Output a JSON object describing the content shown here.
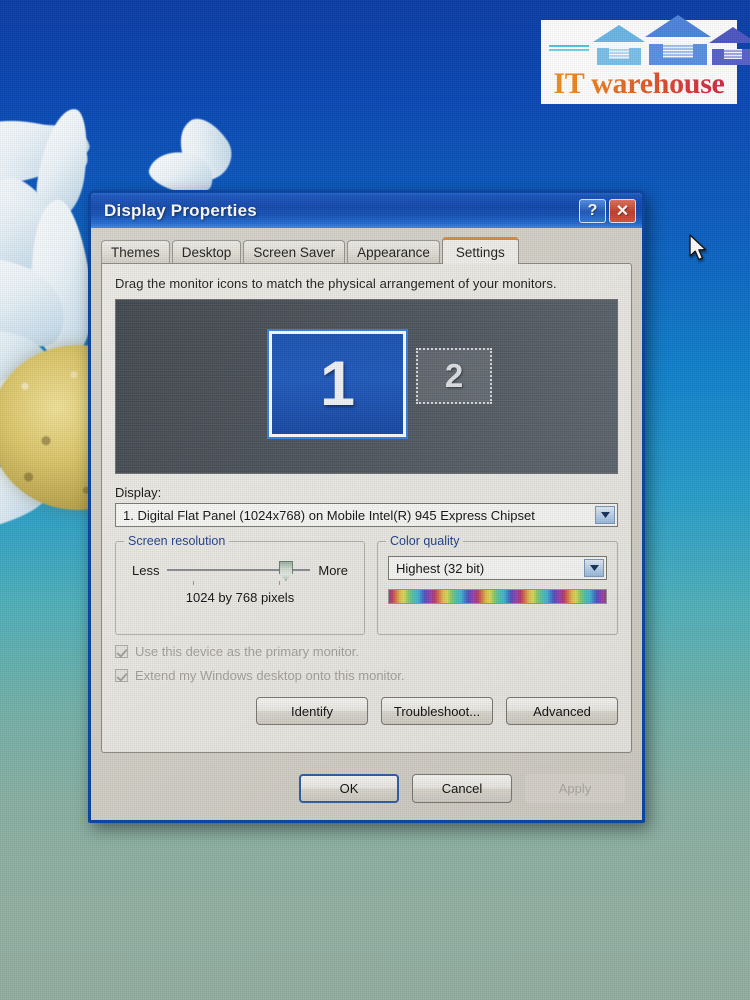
{
  "logo": {
    "text": "IT warehouse",
    "icon_name": "warehouse-logo",
    "colors": {
      "text_start": "#f0931f",
      "text_end": "#cf2a45",
      "house_left": "#6cb8e8",
      "house_center": "#4f86de",
      "house_right": "#5a5fc6",
      "line_left": "#49c2d8",
      "line_right": "#7a6cc8"
    }
  },
  "desktop": {
    "wallpaper_name": "daisy-flower-wallpaper",
    "cursor_name": "arrow-cursor"
  },
  "dialog": {
    "title": "Display Properties",
    "help_button": "?",
    "close_button": "✕",
    "tabs": [
      {
        "label": "Themes",
        "active": false
      },
      {
        "label": "Desktop",
        "active": false
      },
      {
        "label": "Screen Saver",
        "active": false
      },
      {
        "label": "Appearance",
        "active": false
      },
      {
        "label": "Settings",
        "active": true
      }
    ],
    "settings": {
      "hint": "Drag the monitor icons to match the physical arrangement of your monitors.",
      "monitors": [
        {
          "number": "1",
          "selected": true
        },
        {
          "number": "2",
          "selected": false
        }
      ],
      "display_label": "Display:",
      "display_value": "1. Digital Flat Panel (1024x768) on Mobile Intel(R) 945 Express Chipset",
      "screen_resolution": {
        "legend": "Screen resolution",
        "less_label": "Less",
        "more_label": "More",
        "value": "1024 by 768 pixels",
        "slider_percent": 78
      },
      "color_quality": {
        "legend": "Color quality",
        "value": "Highest (32 bit)"
      },
      "checkboxes": [
        {
          "label": "Use this device as the primary monitor.",
          "checked": true,
          "disabled": true
        },
        {
          "label": "Extend my Windows desktop onto this monitor.",
          "checked": true,
          "disabled": true
        }
      ],
      "action_buttons": [
        {
          "label": "Identify",
          "disabled": false
        },
        {
          "label": "Troubleshoot...",
          "disabled": false
        },
        {
          "label": "Advanced",
          "disabled": false
        }
      ]
    },
    "footer_buttons": [
      {
        "label": "OK",
        "disabled": false,
        "default": true
      },
      {
        "label": "Cancel",
        "disabled": false,
        "default": false
      },
      {
        "label": "Apply",
        "disabled": true,
        "default": false
      }
    ]
  }
}
